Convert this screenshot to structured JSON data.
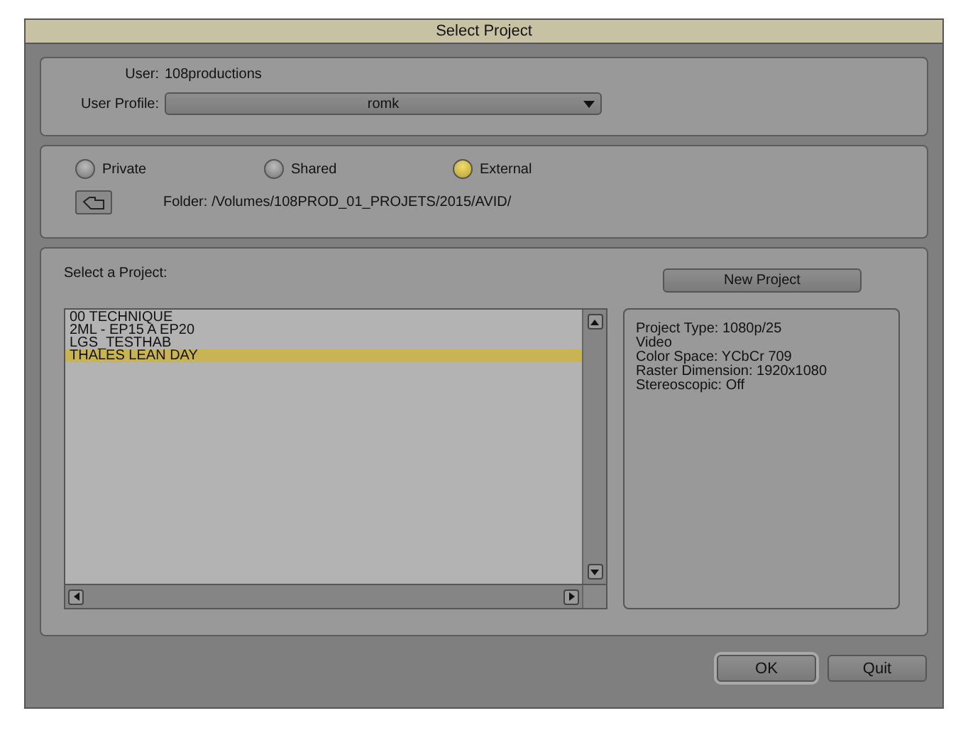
{
  "window": {
    "title": "Select Project"
  },
  "user": {
    "label": "User:",
    "value": "108productions"
  },
  "user_profile": {
    "label": "User Profile:",
    "value": "romk"
  },
  "locations": [
    {
      "label": "Private",
      "selected": false
    },
    {
      "label": "Shared",
      "selected": false
    },
    {
      "label": "External",
      "selected": true
    }
  ],
  "folder": {
    "label": "Folder:",
    "value": "/Volumes/108PROD_01_PROJETS/2015/AVID/"
  },
  "projects": {
    "label": "Select a Project:",
    "items": [
      {
        "name": "00 TECHNIQUE",
        "selected": false
      },
      {
        "name": "2ML - EP15 A EP20",
        "selected": false
      },
      {
        "name": "LGS_TESTHAB",
        "selected": false
      },
      {
        "name": "THALES LEAN DAY",
        "selected": true
      }
    ]
  },
  "new_project_button": "New Project",
  "project_info": [
    "Project Type: 1080p/25",
    "Video",
    "Color Space: YCbCr 709",
    "Raster Dimension: 1920x1080",
    "Stereoscopic: Off"
  ],
  "buttons": [
    {
      "label": "OK",
      "default": true
    },
    {
      "label": "Quit",
      "default": false
    }
  ]
}
